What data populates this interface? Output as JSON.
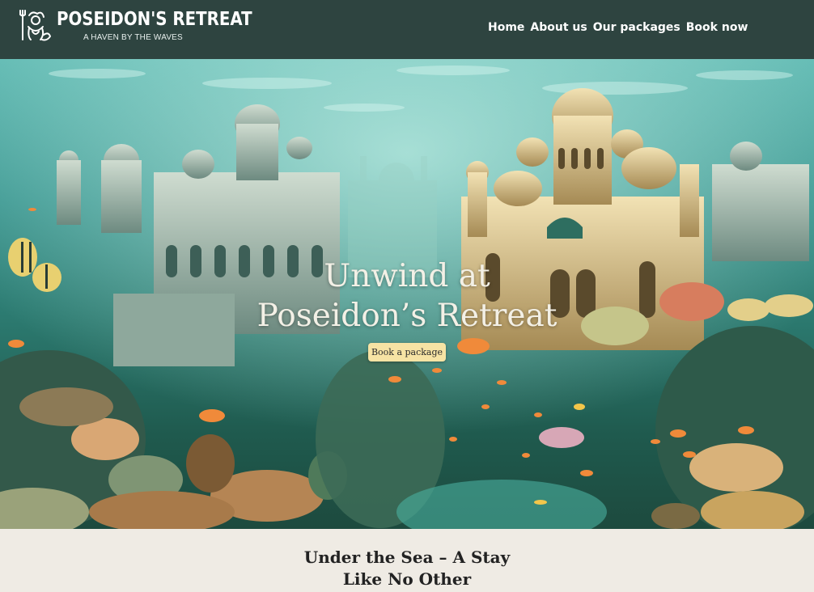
{
  "brand": {
    "name": "POSEIDON'S RETREAT",
    "tagline": "A HAVEN BY THE WAVES",
    "logo_icon": "poseidon-trident-logo-icon"
  },
  "nav": {
    "items": [
      {
        "label": "Home"
      },
      {
        "label": "About us"
      },
      {
        "label": "Our packages"
      },
      {
        "label": "Book now"
      }
    ]
  },
  "hero": {
    "title_line1": "Unwind at",
    "title_line2": "Poseidon’s Retreat",
    "cta_label": "Book a package",
    "image_description": "underwater-palace-coral-reef-illustration"
  },
  "intro": {
    "heading_line1": "Under the Sea – A Stay",
    "heading_line2": "Like No Other"
  },
  "colors": {
    "header_bg": "#2e4440",
    "page_bg": "#efebe4",
    "cta_bg": "#f6e3a4",
    "sea_light": "#5fb9b2",
    "sea_dark": "#1d4a3e"
  }
}
